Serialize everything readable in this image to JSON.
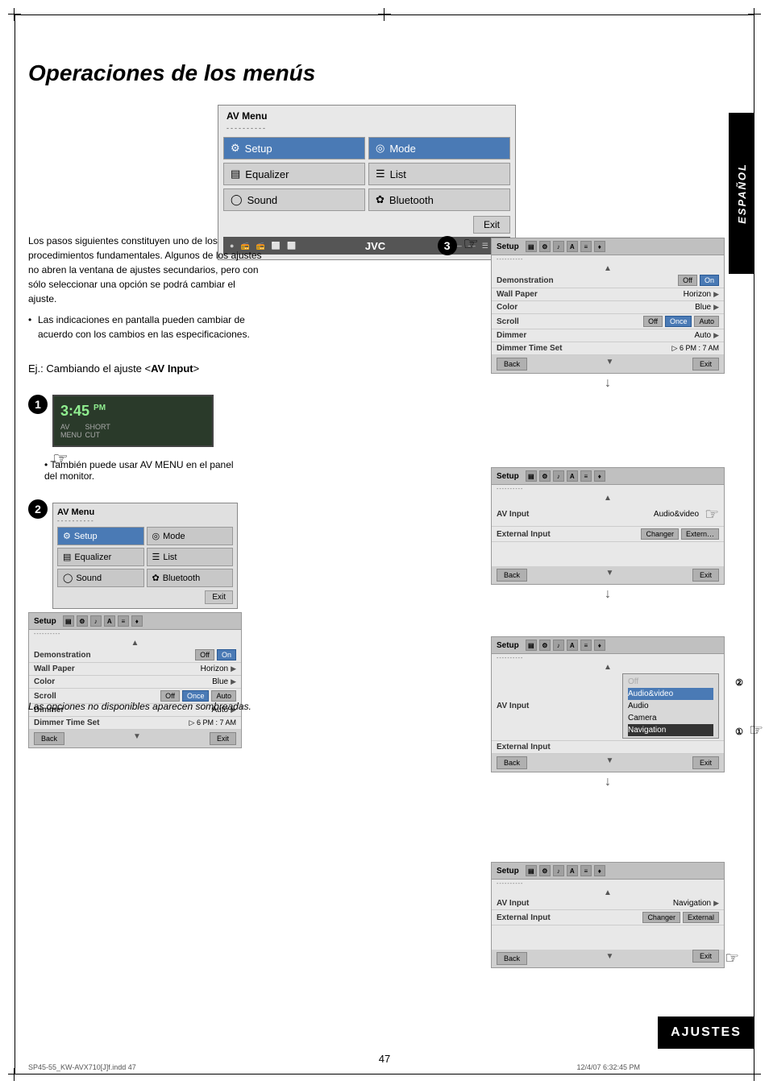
{
  "page": {
    "title": "Operaciones de los menús",
    "page_number": "47",
    "footer_left": "SP45-55_KW-AVX710[J]f.indd  47",
    "footer_right": "12/4/07  6:32:45 PM"
  },
  "sidebar": {
    "espanol": "ESPAÑOL",
    "ajustes": "AJUSTES"
  },
  "av_menu_top": {
    "title": "AV Menu",
    "dots": "----------",
    "items": [
      {
        "icon": "⚙",
        "label": "Setup"
      },
      {
        "icon": "◎",
        "label": "Mode"
      },
      {
        "icon": "▤",
        "label": "Equalizer"
      },
      {
        "icon": "☰",
        "label": "List"
      },
      {
        "icon": "◯",
        "label": "Sound"
      },
      {
        "icon": "✿",
        "label": "Bluetooth"
      }
    ],
    "exit_label": "Exit",
    "jvc": "JVC"
  },
  "body_text": {
    "para1": "Los pasos siguientes constituyen uno de los procedimientos fundamentales. Algunos de los ajustes no abren la ventana de ajustes secundarios, pero con sólo seleccionar una opción se podrá cambiar el ajuste.",
    "bullet1": "Las indicaciones en pantalla pueden cambiar de acuerdo con los cambios en las especificaciones.",
    "ej_label": "Ej.: Cambiando el ajuste <AV Input>"
  },
  "step1": {
    "num": "1",
    "time": "3:45 PM",
    "menu_labels": "AV MENU  SHORT CUT",
    "bullet": "• También puede usar AV MENU en el panel del monitor."
  },
  "step2": {
    "num": "2",
    "av_menu": {
      "title": "AV Menu",
      "dots": "----------",
      "items": [
        {
          "icon": "⚙",
          "label": "Setup",
          "highlighted": true
        },
        {
          "icon": "◎",
          "label": "Mode"
        },
        {
          "icon": "▤",
          "label": "Equalizer"
        },
        {
          "icon": "☰",
          "label": "List"
        },
        {
          "icon": "◯",
          "label": "Sound"
        },
        {
          "icon": "✿",
          "label": "Bluetooth"
        }
      ],
      "exit_label": "Exit"
    }
  },
  "setup_panel_left": {
    "title": "Setup",
    "dots": "----------",
    "rows": [
      {
        "label": "Demonstration",
        "values": [
          "Off",
          "On"
        ]
      },
      {
        "label": "Wall Paper",
        "values": [
          "Horizon"
        ],
        "arrow": true
      },
      {
        "label": "Color",
        "values": [
          "Blue"
        ],
        "arrow": true
      },
      {
        "label": "Scroll",
        "values": [
          "Off",
          "Once",
          "Auto"
        ]
      },
      {
        "label": "Dimmer",
        "values": [
          "Auto"
        ],
        "arrow": true
      },
      {
        "label": "Dimmer Time Set",
        "values": [
          "3  6 PM  :  7 AM"
        ]
      }
    ],
    "back_label": "Back",
    "exit_label": "Exit"
  },
  "las_opciones": "Las opciones no disponibles aparecen sombreadas.",
  "step3": {
    "num": "3"
  },
  "right_panels": {
    "panel1": {
      "title": "Setup",
      "rows": [
        {
          "label": "Demonstration",
          "values": [
            "Off",
            "On"
          ]
        },
        {
          "label": "Wall Paper",
          "values": [
            "Horizon"
          ],
          "arrow": true
        },
        {
          "label": "Color",
          "values": [
            "Blue"
          ],
          "arrow": true
        },
        {
          "label": "Scroll",
          "values": [
            "Off",
            "Once",
            "Auto"
          ]
        },
        {
          "label": "Dimmer",
          "values": [
            "Auto"
          ],
          "arrow": true
        },
        {
          "label": "Dimmer Time Set",
          "values": [
            "3  6 PM  :  7 AM"
          ]
        }
      ],
      "back_label": "Back",
      "exit_label": "Exit"
    },
    "panel2": {
      "title": "Setup",
      "rows": [
        {
          "label": "AV Input",
          "values": [
            "Audio&video"
          ],
          "arrow": false
        },
        {
          "label": "External Input",
          "values": [
            "Changer",
            "Extern…"
          ]
        }
      ],
      "back_label": "Back",
      "exit_label": "Exit"
    },
    "panel3": {
      "title": "Setup",
      "rows": [
        {
          "label": "AV Input",
          "values": [
            "Off"
          ]
        },
        {
          "label": "",
          "values": [
            "Audio&video"
          ]
        },
        {
          "label": "External Input",
          "values": [
            "Audio"
          ]
        },
        {
          "label": "",
          "values": [
            "Camera"
          ]
        },
        {
          "label": "",
          "values": [
            "Navigation"
          ]
        }
      ],
      "back_label": "Back",
      "exit_label": "Exit",
      "annotations": [
        "②",
        "①"
      ]
    },
    "panel4": {
      "title": "Setup",
      "rows": [
        {
          "label": "AV Input",
          "values": [
            "Navigation"
          ],
          "arrow": true
        },
        {
          "label": "External Input",
          "values": [
            "Changer",
            "External"
          ]
        }
      ],
      "back_label": "Back",
      "exit_label": "Exit"
    }
  }
}
